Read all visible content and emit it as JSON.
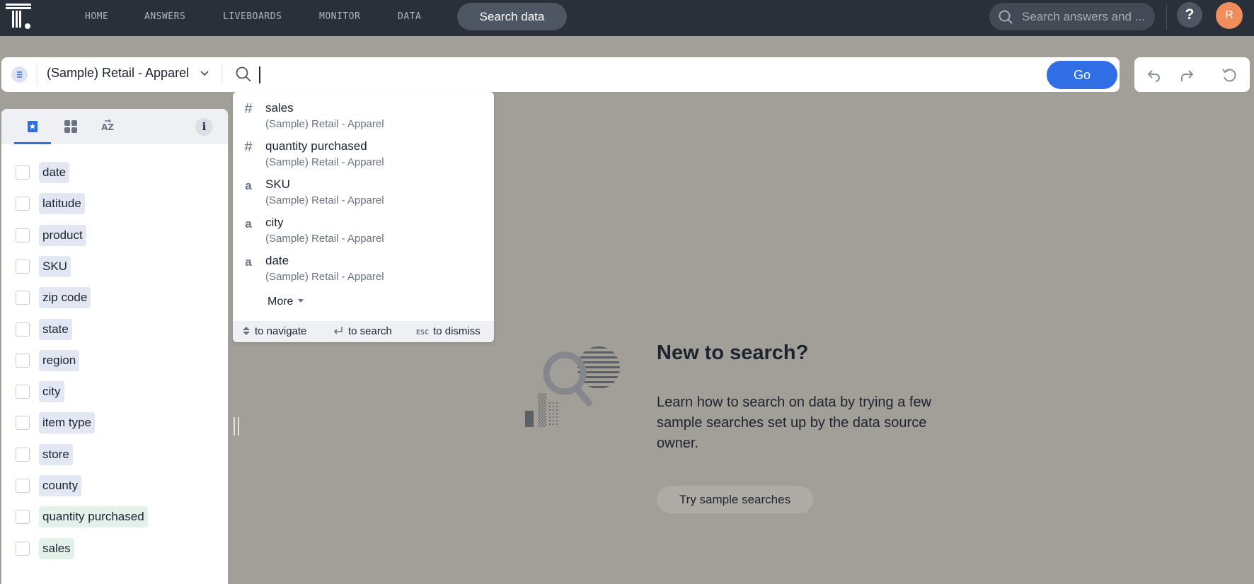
{
  "nav": {
    "items": [
      "HOME",
      "ANSWERS",
      "LIVEBOARDS",
      "MONITOR",
      "DATA"
    ],
    "search_data_label": "Search data",
    "global_search_placeholder": "Search answers and ...",
    "help_label": "?",
    "avatar_initial": "R"
  },
  "searchbar": {
    "source_name": "(Sample) Retail - Apparel",
    "query": "",
    "go_label": "Go"
  },
  "left_panel": {
    "info_label": "i",
    "columns": [
      {
        "name": "date",
        "kind": "attribute"
      },
      {
        "name": "latitude",
        "kind": "attribute"
      },
      {
        "name": "product",
        "kind": "attribute"
      },
      {
        "name": "SKU",
        "kind": "attribute"
      },
      {
        "name": "zip code",
        "kind": "attribute"
      },
      {
        "name": "state",
        "kind": "attribute"
      },
      {
        "name": "region",
        "kind": "attribute"
      },
      {
        "name": "city",
        "kind": "attribute"
      },
      {
        "name": "item type",
        "kind": "attribute"
      },
      {
        "name": "store",
        "kind": "attribute"
      },
      {
        "name": "county",
        "kind": "attribute"
      },
      {
        "name": "quantity purchased",
        "kind": "measure"
      },
      {
        "name": "sales",
        "kind": "measure"
      }
    ]
  },
  "dropdown": {
    "suggestions": [
      {
        "type_glyph": "#",
        "name": "sales",
        "source": "(Sample) Retail - Apparel"
      },
      {
        "type_glyph": "#",
        "name": "quantity purchased",
        "source": "(Sample) Retail - Apparel"
      },
      {
        "type_glyph": "a",
        "name": "SKU",
        "source": "(Sample) Retail - Apparel"
      },
      {
        "type_glyph": "a",
        "name": "city",
        "source": "(Sample) Retail - Apparel"
      },
      {
        "type_glyph": "a",
        "name": "date",
        "source": "(Sample) Retail - Apparel"
      }
    ],
    "more_label": "More",
    "footer": {
      "navigate": "to navigate",
      "search": "to search",
      "esc_key": "ESC",
      "dismiss": "to dismiss"
    }
  },
  "empty_state": {
    "title": "New to search?",
    "description": "Learn how to search on data by trying a few sample searches set up by the data source owner.",
    "button_label": "Try sample searches"
  },
  "colors": {
    "topnav_bg": "#2a3039",
    "canvas_bg": "#a29f98",
    "accent": "#2f6ee5",
    "avatar": "#f08d5b",
    "attribute_chip": "#e3e7f3",
    "measure_chip": "#e2f1ea"
  }
}
